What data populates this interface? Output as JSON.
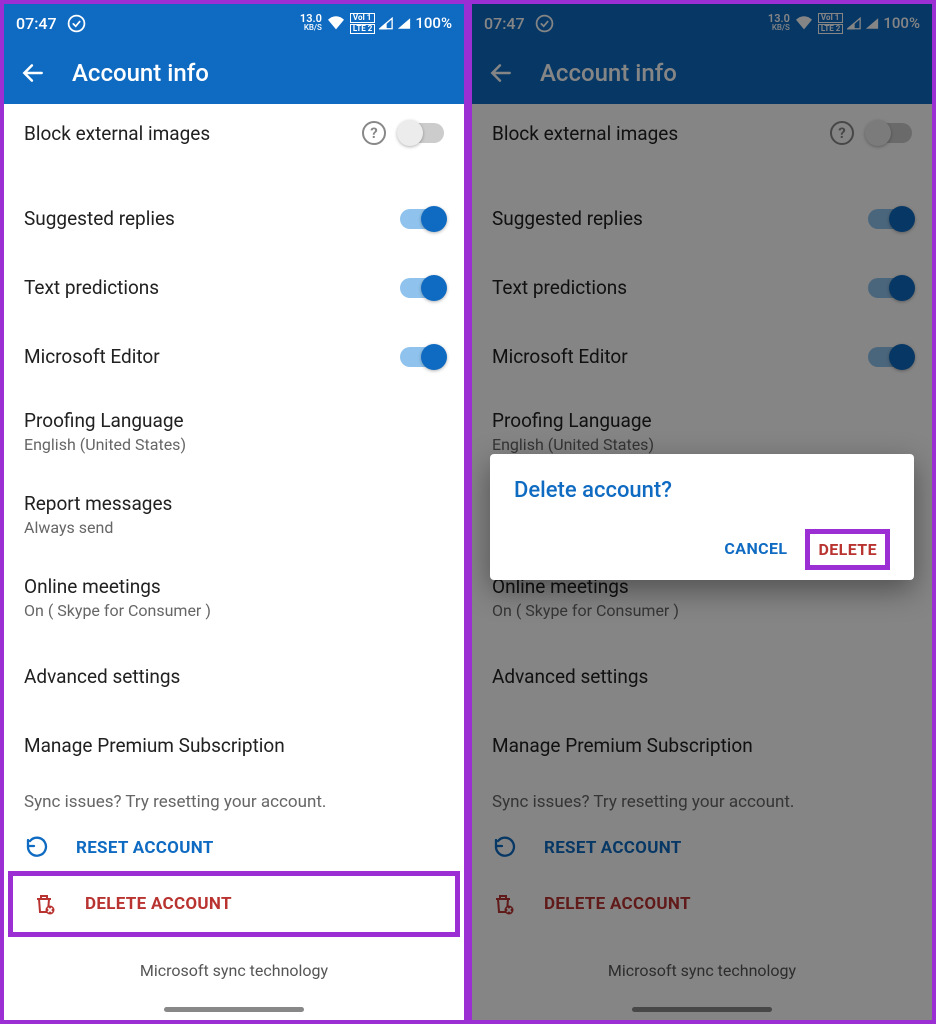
{
  "status": {
    "time": "07:47",
    "kbps_num": "13.0",
    "kbps_unit": "KB/S",
    "lte1": "VoI 1",
    "lte2": "LTE 2",
    "battery": "100%"
  },
  "appbar": {
    "title": "Account info"
  },
  "settings": {
    "block_external_images": "Block external images",
    "suggested_replies": "Suggested replies",
    "text_predictions": "Text predictions",
    "microsoft_editor": "Microsoft Editor",
    "proofing_lang": "Proofing Language",
    "proofing_value": "English (United States)",
    "report_messages": "Report messages",
    "report_value": "Always send",
    "online_meetings": "Online meetings",
    "online_value": "On ( Skype for Consumer )",
    "advanced": "Advanced settings",
    "manage_premium": "Manage Premium Subscription",
    "sync_hint": "Sync issues? Try resetting your account.",
    "reset": "RESET ACCOUNT",
    "delete": "DELETE ACCOUNT",
    "footer": "Microsoft sync technology"
  },
  "dialog": {
    "title": "Delete account?",
    "cancel": "CANCEL",
    "delete": "DELETE"
  }
}
